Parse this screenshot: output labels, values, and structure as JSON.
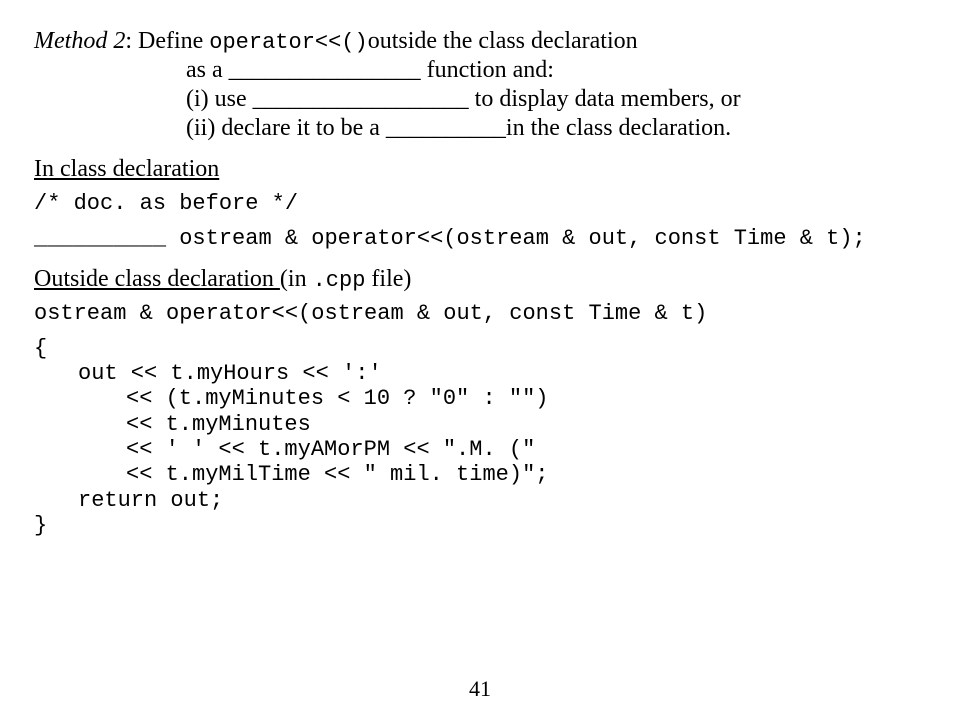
{
  "title": {
    "method_label": "Method 2",
    "text1_pre": ": Define ",
    "code_operator": "operator<<()",
    "text1_post": "outside the class declaration",
    "line2_pre": "as a ",
    "blank1": "________________",
    "line2_post": " function and:",
    "line3_pre": "(i) use ",
    "blank2": "__________________",
    "line3_post": " to display data members, or",
    "line4_pre": "(ii) declare it to be a ",
    "blank3": "__________",
    "line4_post": "in the class declaration."
  },
  "section1": {
    "heading": "In class declaration",
    "code_comment": "/* doc. as before */",
    "blank4": "__________",
    "code_decl": " ostream & operator<<(ostream & out, const Time & t);"
  },
  "section2": {
    "heading_pre": "Outside class declaration ",
    "heading_paren_pre": "(in ",
    "code_cpp": ".cpp",
    "heading_paren_post": " file)",
    "line1": "ostream & operator<<(ostream & out, const Time & t)",
    "line2": "{",
    "line3": "out << t.myHours << ':'",
    "line4": "<< (t.myMinutes < 10 ? \"0\" : \"\")",
    "line5": "<< t.myMinutes",
    "line6": "<< ' ' << t.myAMorPM << \".M.  (\"",
    "line7": "<< t.myMilTime << \" mil. time)\";",
    "line8": "return out;",
    "line9": "}"
  },
  "page_number": "41"
}
